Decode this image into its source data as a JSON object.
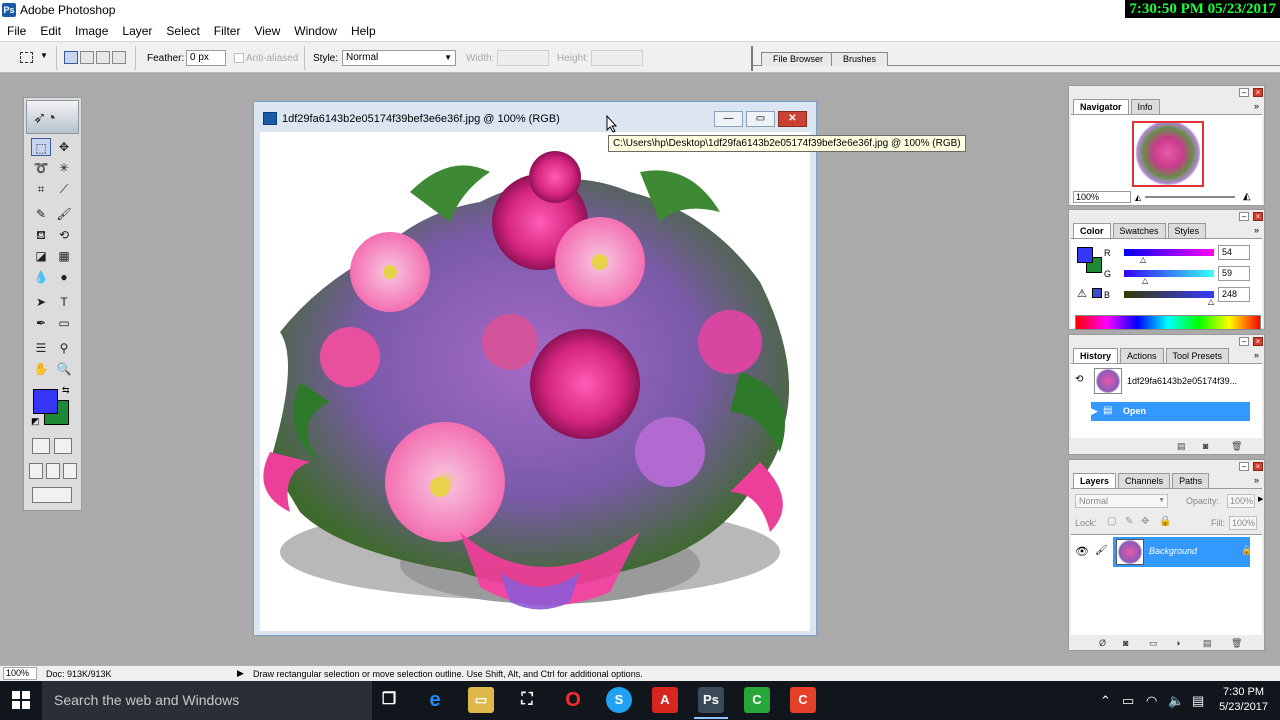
{
  "app": {
    "title": "Adobe Photoshop",
    "overlay_clock": "7:30:50 PM 05/23/2017"
  },
  "menubar": {
    "items": [
      "File",
      "Edit",
      "Image",
      "Layer",
      "Select",
      "Filter",
      "View",
      "Window",
      "Help"
    ]
  },
  "options_bar": {
    "feather_label": "Feather:",
    "feather_value": "0 px",
    "anti_aliased_label": "Anti-aliased",
    "style_label": "Style:",
    "style_value": "Normal",
    "width_label": "Width:",
    "height_label": "Height:",
    "well_tabs": [
      "File Browser",
      "Brushes"
    ]
  },
  "document": {
    "title": "1df29fa6143b2e05174f39bef3e6e36f.jpg @ 100% (RGB)",
    "tooltip": "C:\\Users\\hp\\Desktop\\1df29fa6143b2e05174f39bef3e6e36f.jpg @ 100% (RGB)"
  },
  "navigator": {
    "tabs": [
      "Navigator",
      "Info"
    ],
    "zoom": "100%"
  },
  "color": {
    "tabs": [
      "Color",
      "Swatches",
      "Styles"
    ],
    "r_label": "R",
    "g_label": "G",
    "b_label": "B",
    "r": "54",
    "g": "59",
    "b": "248",
    "fg": "#3636f8",
    "bg": "#1f8a36"
  },
  "history": {
    "tabs": [
      "History",
      "Actions",
      "Tool Presets"
    ],
    "snapshot": "1df29fa6143b2e05174f39...",
    "state": "Open"
  },
  "layers": {
    "tabs": [
      "Layers",
      "Channels",
      "Paths"
    ],
    "blend_mode": "Normal",
    "opacity_label": "Opacity:",
    "opacity": "100%",
    "lock_label": "Lock:",
    "fill_label": "Fill:",
    "fill": "100%",
    "layer_name": "Background"
  },
  "status": {
    "zoom": "100%",
    "doc": "Doc: 913K/913K",
    "hint": "Draw rectangular selection or move selection outline.  Use Shift, Alt, and Ctrl for additional options."
  },
  "taskbar": {
    "search_placeholder": "Search the web and Windows",
    "time": "7:30 PM",
    "date": "5/23/2017"
  },
  "colors": {
    "accent": "#3399ff",
    "selection": "#3399ff"
  }
}
